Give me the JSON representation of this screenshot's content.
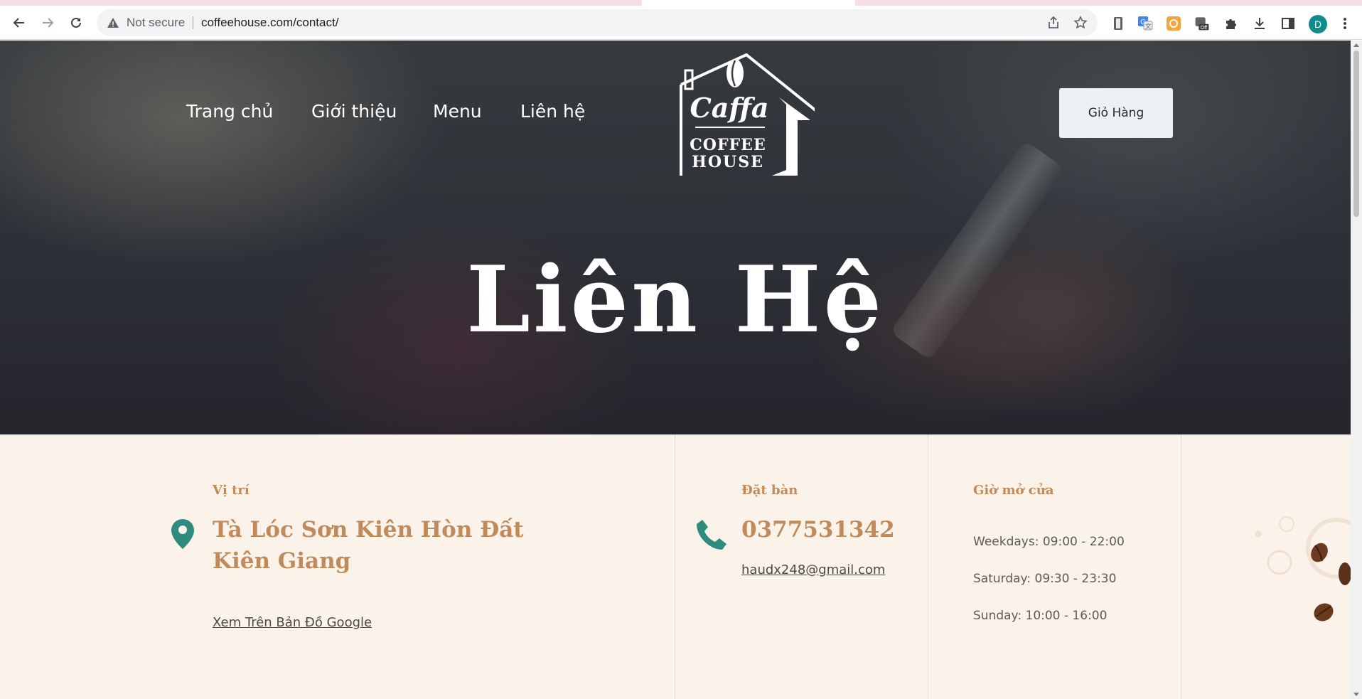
{
  "browser": {
    "security_label": "Not secure",
    "url": "coffeehouse.com/contact/",
    "profile_initial": "D",
    "ext_badge": "Off"
  },
  "nav": {
    "items": [
      "Trang chủ",
      "Giới thiệu",
      "Menu",
      "Liên hệ"
    ],
    "cart_label": "Giỏ Hàng"
  },
  "logo": {
    "script_text": "Caffa",
    "line1": "COFFEE",
    "line2": "HOUSE"
  },
  "hero": {
    "title": "Liên Hệ"
  },
  "location": {
    "label": "Vị trí",
    "address_line1": "Tà Lóc Sơn Kiên Hòn Đất",
    "address_line2": "Kiên Giang",
    "map_link": "Xem Trên Bản Đồ Google"
  },
  "booking": {
    "label": "Đặt bàn",
    "phone": "0377531342",
    "email": "haudx248@gmail.com"
  },
  "hours": {
    "label": "Giờ mở cửa",
    "weekdays": "Weekdays: 09:00 - 22:00",
    "saturday": "Saturday: 09:30 - 23:30",
    "sunday": "Sunday: 10:00 - 16:00"
  },
  "colors": {
    "accent": "#c08a5a",
    "icon_teal": "#2e8b7e",
    "band_bg": "#fbf3ea"
  }
}
